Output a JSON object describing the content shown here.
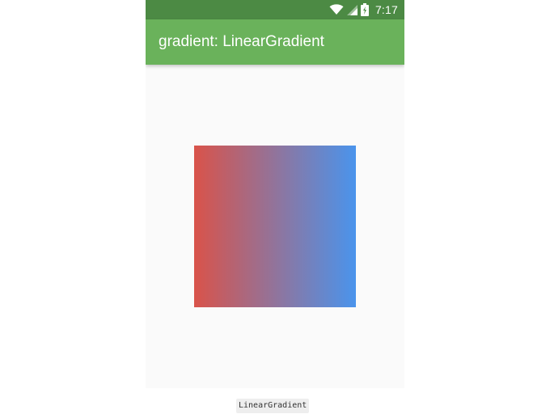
{
  "status_bar": {
    "time": "7:17",
    "icons": [
      "wifi-icon",
      "cell-signal-icon",
      "battery-charging-icon"
    ],
    "color": "#4c8a44"
  },
  "app_bar": {
    "title": "gradient: LinearGradient",
    "color": "#6ab25b"
  },
  "gradient_box": {
    "type": "LinearGradient",
    "direction": "left-to-right",
    "start_color": "#d9534a",
    "end_color": "#4a94ec"
  },
  "caption": {
    "text": "LinearGradient"
  }
}
